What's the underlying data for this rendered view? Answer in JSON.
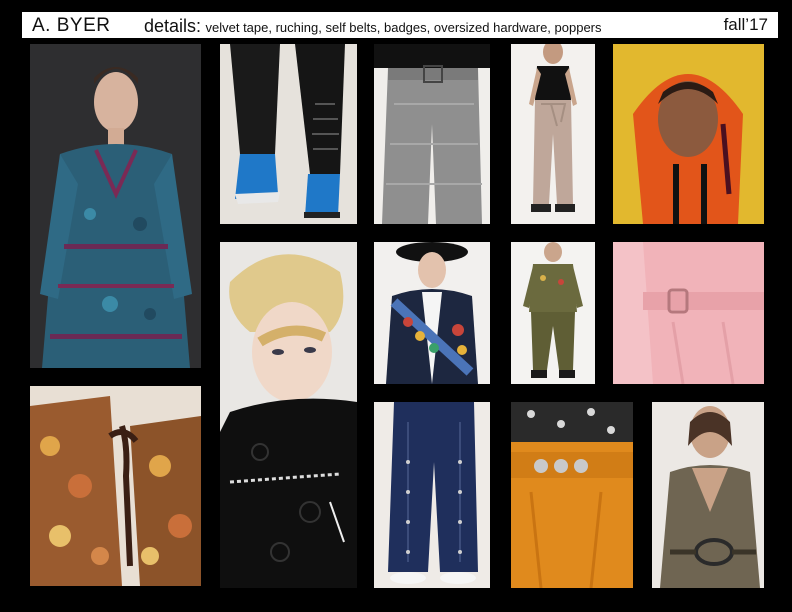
{
  "header": {
    "brand": "A. BYER",
    "details_label": "details:",
    "details_text": "velvet tape, ruching, self belts, badges, oversized hardware, poppers",
    "season": "fall’17"
  },
  "photos": [
    {
      "id": "blue-paisley-dress",
      "color": "#2b5f77"
    },
    {
      "id": "ruched-black-pants-blue-boots",
      "color": "#1a1a1a"
    },
    {
      "id": "houndstooth-belted-trousers",
      "color": "#8a8a8a"
    },
    {
      "id": "cold-shoulder-top-belted-pants",
      "color": "#bfa79a"
    },
    {
      "id": "orange-hoodie-portrait",
      "color": "#e2551a"
    },
    {
      "id": "blonde-model-black-lace",
      "color": "#d8c08a"
    },
    {
      "id": "navy-coat-with-badges",
      "color": "#1d2740"
    },
    {
      "id": "olive-set-with-badges",
      "color": "#6b6a3e"
    },
    {
      "id": "pink-belted-dress-detail",
      "color": "#f1b3b9"
    },
    {
      "id": "floral-pants-velvet-tie",
      "color": "#9a5b2f"
    },
    {
      "id": "denim-popper-wide-pants",
      "color": "#1f2f5c"
    },
    {
      "id": "orange-pants-hardware-detail",
      "color": "#e08a1d"
    },
    {
      "id": "olive-wrap-dress-belt",
      "color": "#6f6552"
    }
  ]
}
